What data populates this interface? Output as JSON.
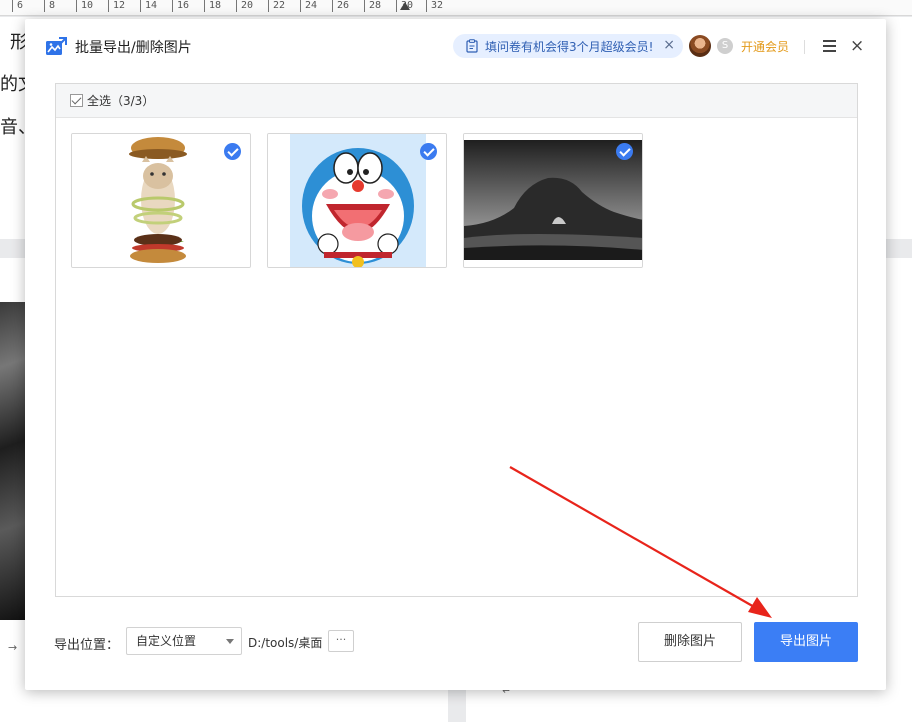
{
  "ruler": {
    "ticks": [
      "6",
      "8",
      "10",
      "12",
      "14",
      "16",
      "18",
      "20",
      "22",
      "24",
      "26",
      "28",
      "30",
      "32"
    ]
  },
  "document": {
    "lines": [
      "形",
      "的文",
      "音、"
    ],
    "marks": [
      "→",
      "↵"
    ]
  },
  "dialog": {
    "title": "批量导出/删除图片",
    "promo_text": "填问卷有机会得3个月超级会员!",
    "promo_close": "×",
    "vip_badge": "S",
    "vip_link": "开通会员",
    "close_glyph": "×"
  },
  "image_list": {
    "select_all_label": "全选（3/3）",
    "items": [
      {
        "name": "cat-burger-image",
        "selected": true
      },
      {
        "name": "doraemon-image",
        "selected": true
      },
      {
        "name": "sea-rock-image",
        "selected": true
      }
    ]
  },
  "footer": {
    "location_label": "导出位置：",
    "location_option": "自定义位置",
    "path": "D:/tools/桌面",
    "browse_label": "···",
    "delete_label": "删除图片",
    "export_label": "导出图片"
  },
  "colors": {
    "accent": "#3b7ef5",
    "vip": "#e39a1a",
    "promo_bg": "#e6efff",
    "arrow": "#e8241b"
  }
}
